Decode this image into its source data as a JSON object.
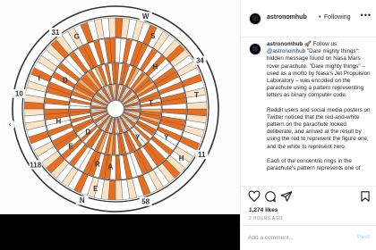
{
  "colors": {
    "orange": "#e86d1f",
    "light_orange": "#f3b06b",
    "white": "#ffffff",
    "dark": "#3a3a3a",
    "link": "#00376b"
  },
  "image": {
    "outer_ring": [
      {
        "label": "W",
        "angle": -72
      },
      {
        "label": "34",
        "angle": -30
      },
      {
        "label": "11",
        "angle": 28
      },
      {
        "label": "58",
        "angle": 72
      },
      {
        "label": "N",
        "angle": 110
      },
      {
        "label": "118",
        "angle": 145
      },
      {
        "label": "10",
        "angle": 189
      },
      {
        "label": "31",
        "angle": 232
      }
    ],
    "inner_letters": [
      {
        "label": "S",
        "angle": -63
      },
      {
        "label": "T",
        "angle": -10
      },
      {
        "label": "H",
        "angle": 37
      },
      {
        "label": "E",
        "angle": 104
      },
      {
        "label": "I",
        "angle": 202
      },
      {
        "label": "G",
        "angle": 242
      }
    ],
    "middle_letters": [
      {
        "label": "H",
        "angle": -47
      },
      {
        "label": "Y",
        "angle": 29
      },
      {
        "label": "A",
        "angle": 95
      },
      {
        "label": "R",
        "angle": 108
      },
      {
        "label": "E",
        "angle": 140
      },
      {
        "label": "H",
        "angle": 168
      },
      {
        "label": "D",
        "angle": 210
      }
    ],
    "innermost_letters": [
      {
        "label": "T",
        "angle": -10
      },
      {
        "label": "Y",
        "angle": 52
      },
      {
        "label": "D",
        "angle": 140
      }
    ],
    "nav_left": "‹"
  },
  "header": {
    "username": "astronomhub",
    "separator": "•",
    "follow_label": "Following",
    "more_label": "•••"
  },
  "caption": {
    "username": "astronomhub",
    "follow_prefix": "🚀 Follow us:",
    "handle": "@astronomhub",
    "body": "\"Dare mighty things\": hidden message found on Nasa Mars rover parachute. \"Dare mighty things\" – used as a motto by Nasa's Jet Propulsion Laboratory – was encoded on the parachute using a pattern representing letters as binary computer code.",
    "paragraph2": "Reddit users and social media posters on Twitter noticed that the red-and-white pattern on the parachute looked deliberate, and arrived at the result by using the red to represent the figure one, and the white to represent zero.",
    "paragraph3": "Each of the concentric rings in the parachute's pattern represents one of"
  },
  "likes": "1,274 likes",
  "time": "2 HOURS AGO",
  "comment": {
    "placeholder": "Add a comment...",
    "post_label": "Post"
  }
}
